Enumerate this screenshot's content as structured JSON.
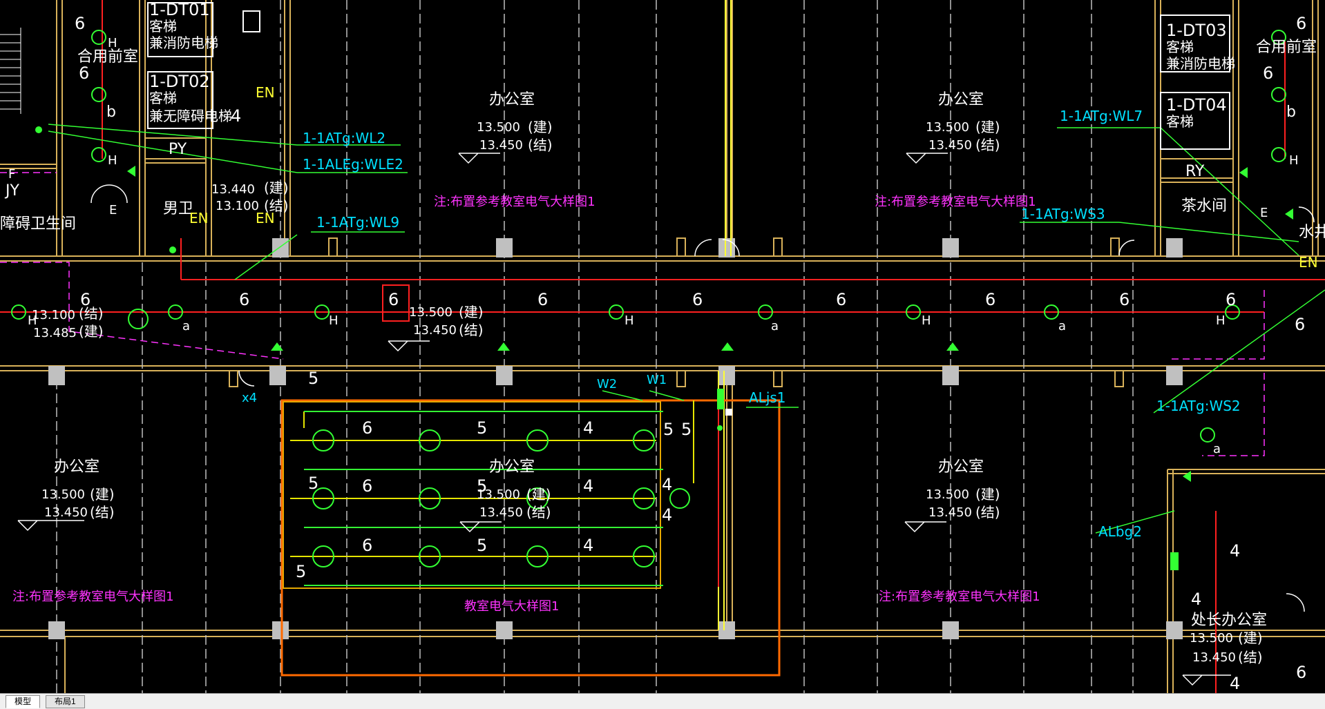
{
  "app": {
    "colors": {
      "background": "#000000",
      "wall": "#d9b25a",
      "circuit": "#ff2020",
      "fixture": "#33ff33",
      "dimension": "#ffffff",
      "note": "#ff33ff",
      "tag": "#00e0ff"
    }
  },
  "tabs": [
    {
      "label": "模型",
      "active": true
    },
    {
      "label": "布局1",
      "active": false
    }
  ],
  "rooms": {
    "office_top_a": {
      "name": "办公室",
      "arch": "13.500",
      "arch_tag": "(建)",
      "str": "13.450",
      "str_tag": "(结)"
    },
    "office_top_b": {
      "name": "办公室",
      "arch": "13.500",
      "arch_tag": "(建)",
      "str": "13.450",
      "str_tag": "(结)"
    },
    "office_bot_a": {
      "name": "办公室",
      "arch": "13.500",
      "arch_tag": "(建)",
      "str": "13.450",
      "str_tag": "(结)"
    },
    "office_bot_b": {
      "name": "办公室",
      "arch": "13.500",
      "arch_tag": "(建)",
      "str": "13.450",
      "str_tag": "(结)"
    },
    "office_bot_c": {
      "name": "办公室",
      "arch": "13.500",
      "arch_tag": "(建)",
      "str": "13.450",
      "str_tag": "(结)"
    },
    "director_office": {
      "name": "处长办公室",
      "arch": "13.500",
      "arch_tag": "(建)",
      "str": "13.450",
      "str_tag": "(结)"
    },
    "corridor": {
      "arch": "13.500",
      "arch_tag": "(建)",
      "str": "13.450",
      "str_tag": "(结)"
    },
    "corridor_left": {
      "arch": "13.100",
      "arch_tag": "(结)",
      "str": "13.485",
      "str_tag": "(建)"
    },
    "toilet": {
      "name": "男卫",
      "arch": "13.440",
      "arch_tag": "(建)",
      "str": "13.100",
      "str_tag": "(结)"
    },
    "lobby_left": {
      "name": "合用前室"
    },
    "lobby_right": {
      "name": "合用前室"
    },
    "tea_room": {
      "name": "茶水间"
    },
    "accessible_wc": {
      "name": "障碍卫生间"
    },
    "pump_right": {
      "name": "水井"
    }
  },
  "elevators": [
    {
      "code": "1-DT01",
      "desc": "客梯",
      "desc2": "兼消防电梯"
    },
    {
      "code": "1-DT02",
      "desc": "客梯",
      "desc2": "兼无障碍电梯"
    },
    {
      "code": "1-DT03",
      "desc": "客梯",
      "desc2": "兼消防电梯"
    },
    {
      "code": "1-DT04",
      "desc": "客梯"
    }
  ],
  "shafts": {
    "py_left": "PY",
    "ry_right": "RY",
    "jy_left": "JY",
    "f_left": "F",
    "e1": "E",
    "e2": "E",
    "en1": "EN",
    "en2": "EN",
    "en3": "EN",
    "en4": "EN"
  },
  "notes": {
    "n1": "注:布置参考教室电气大样图1",
    "n2": "注:布置参考教室电气大样图1",
    "n3": "注:布置参考教室电气大样图1",
    "n4": "注:布置参考教室电气大样图1",
    "detail": "教室电气大样图1"
  },
  "circuit_tags": {
    "wl2": "1-1ATg:WL2",
    "wle2": "1-1ALEg:WLE2",
    "wl9": "1-1ATg:WL9",
    "wl7": "1-1ATg:WL7",
    "ws3": "1-1ATg:WS3",
    "ws2": "1-1ATg:WS2",
    "alj": "ALjs1",
    "albg": "ALbg2",
    "w1": "W1",
    "w2": "W2",
    "x4": "x4"
  },
  "wire_counts": {
    "c1": "6",
    "c2": "6",
    "c3": "6",
    "c4": "6",
    "c5": "6",
    "c6": "6",
    "c7": "6",
    "c8": "6",
    "c9": "6",
    "c10": "6",
    "d1": "6",
    "d2": "6",
    "d3": "6",
    "d4": "5",
    "d5": "5",
    "d6": "5",
    "d7": "5",
    "d8": "4",
    "d9": "4",
    "d10": "4",
    "d11": "5",
    "d12": "5",
    "d13": "4",
    "d14": "4",
    "d15": "5",
    "d16": "5",
    "d17": "5",
    "l1": "6",
    "l2": "6",
    "l3": "b",
    "l4": "4",
    "r1": "6",
    "r2": "6",
    "r3": "b",
    "r4": "4",
    "r5": "4",
    "r6": "4",
    "r7": "6"
  },
  "fixture_marks": {
    "h": "H",
    "a": "a"
  }
}
